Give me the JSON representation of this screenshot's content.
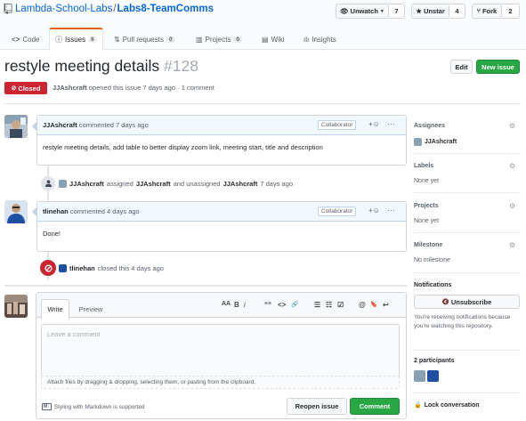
{
  "repo": {
    "owner": "Lambda-School-Labs",
    "separator": "/",
    "name": "Labs8-TeamComms"
  },
  "actions": {
    "watch": {
      "label": "Unwatch",
      "count": "7"
    },
    "star": {
      "label": "Unstar",
      "count": "4"
    },
    "fork": {
      "label": "Fork",
      "count": "2"
    }
  },
  "tabs": [
    {
      "label": "Code",
      "icon": "code-icon"
    },
    {
      "label": "Issues",
      "count": "6",
      "icon": "issue-opened-icon"
    },
    {
      "label": "Pull requests",
      "count": "0",
      "icon": "git-pull-request-icon"
    },
    {
      "label": "Projects",
      "count": "0",
      "icon": "project-icon"
    },
    {
      "label": "Wiki",
      "icon": "book-icon"
    },
    {
      "label": "Insights",
      "icon": "graph-icon"
    }
  ],
  "issue": {
    "title": "restyle meeting details",
    "number": "#128",
    "state": "Closed",
    "author": "JJAshcraft",
    "opened_text": "opened this issue 7 days ago · 1 comment",
    "edit_label": "Edit",
    "new_issue_label": "New issue"
  },
  "timeline": {
    "comment1": {
      "author": "JJAshcraft",
      "meta": "commented 7 days ago",
      "role": "Collaborator",
      "body": "restyle meeting details, add table to better display zoom link, meeting start, title and description"
    },
    "event1": {
      "actor": "JJAshcraft",
      "action1": "assigned",
      "target": "JJAshcraft",
      "action2": "and unassigned",
      "target2": "JJAshcraft",
      "time": "7 days ago"
    },
    "comment2": {
      "author": "tlinehan",
      "meta": "commented 4 days ago",
      "role": "Collaborator",
      "body": "Done!"
    },
    "event2": {
      "actor": "tlinehan",
      "text": "closed this 4 days ago"
    }
  },
  "composer": {
    "tab_write": "Write",
    "tab_preview": "Preview",
    "placeholder": "Leave a comment",
    "attach_text": "Attach files by dragging & dropping, selecting them, or pasting from the clipboard.",
    "markdown_note": "Styling with Markdown is supported",
    "reopen_label": "Reopen issue",
    "comment_label": "Comment",
    "tools": [
      "AA",
      "B",
      "i",
      "““",
      "<>",
      "🔗",
      "☰",
      "☷",
      "☑",
      "@",
      "🔖",
      "↩"
    ]
  },
  "sidebar": {
    "assignees": {
      "label": "Assignees",
      "value": "JJAshcraft"
    },
    "labels": {
      "label": "Labels",
      "value": "None yet"
    },
    "projects": {
      "label": "Projects",
      "value": "None yet"
    },
    "milestone": {
      "label": "Milestone",
      "value": "No milestone"
    },
    "notifications": {
      "label": "Notifications",
      "button": "Unsubscribe",
      "notice": "You're receiving notifications because you're watching this repository."
    },
    "participants": {
      "label": "2 participants"
    },
    "lock": {
      "label": "Lock conversation"
    }
  },
  "colors": {
    "link": "#0366d6",
    "closed": "#cb2431",
    "green": "#28a745",
    "active_tab": "#e36209"
  }
}
